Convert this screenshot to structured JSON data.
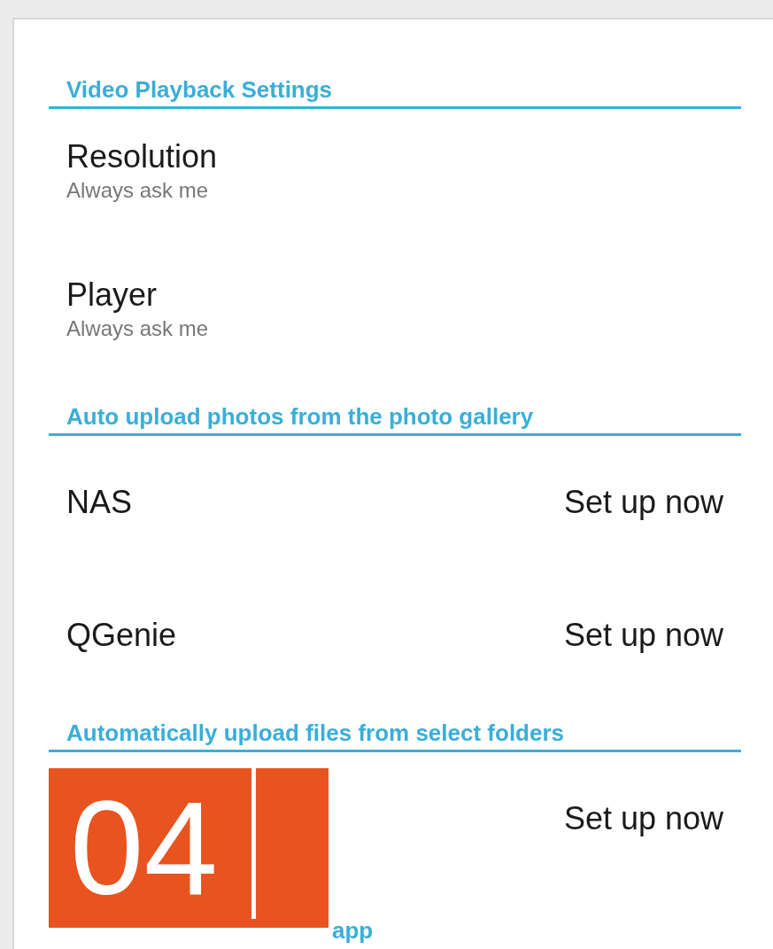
{
  "sections": [
    {
      "header": "Video Playback Settings",
      "items": [
        {
          "kind": "detail",
          "title": "Resolution",
          "subtitle": "Always ask me"
        },
        {
          "kind": "detail",
          "title": "Player",
          "subtitle": "Always ask me"
        }
      ]
    },
    {
      "header": "Auto upload photos from the photo gallery",
      "items": [
        {
          "kind": "value",
          "title": "NAS",
          "value": "Set up now"
        },
        {
          "kind": "value",
          "title": "QGenie",
          "value": "Set up now"
        }
      ]
    },
    {
      "header": "Automatically upload files from select folders",
      "items": [
        {
          "kind": "value",
          "value": "Set up now"
        }
      ]
    },
    {
      "header": "app"
    }
  ],
  "step_badge": {
    "number": "04"
  }
}
